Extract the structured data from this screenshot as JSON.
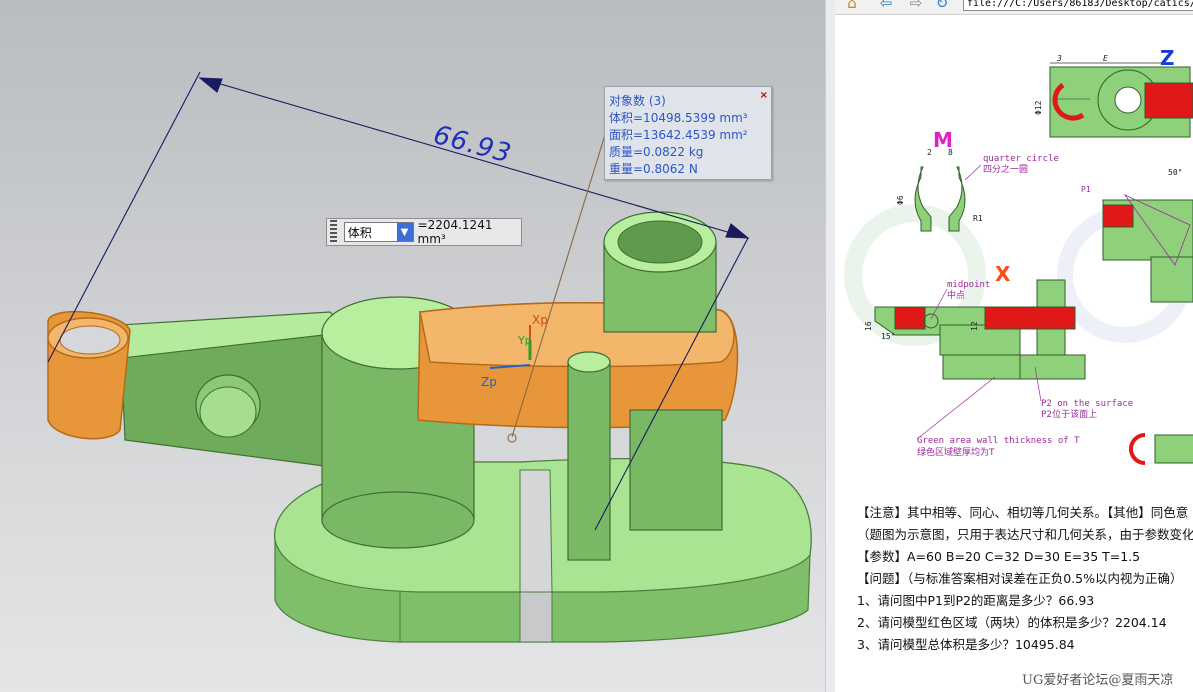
{
  "viewport": {
    "dimension_value": "66.93",
    "colors": {
      "model_green": "#8fd07a",
      "highlight_orange": "#f0a84a",
      "dim_line": "#1a1a5e"
    },
    "info_panel": {
      "lines": [
        "对象数 (3)",
        "体积=10498.5399 mm³",
        "面积=13642.4539 mm²",
        "质量=0.0822 kg",
        "重量=0.8062 N"
      ],
      "close": "×"
    },
    "measure_toolbar": {
      "select_value": "体积",
      "result": "=2204.1241 mm³"
    },
    "csys": {
      "x_label": "Xp",
      "y_label": "Yp",
      "z_label": "Zp"
    }
  },
  "browser": {
    "address": "file:///C:/Users/86183/Desktop/catics/",
    "drawing": {
      "view_labels": {
        "m": "M",
        "x": "X",
        "z": "Z"
      },
      "dims": {
        "three": "3",
        "e": "E",
        "phi12": "Φ12",
        "eight": "8",
        "two": "2",
        "phi6": "Φ6",
        "r1": "R1",
        "sixteen": "16",
        "twelve": "12",
        "fifteen": "15°",
        "fifty": "50°"
      },
      "annotations": {
        "quarter_en": "quarter circle",
        "quarter_cn": "四分之一圆",
        "midpoint_en": "midpoint",
        "midpoint_cn": "中点",
        "p1": "P1",
        "p2_en": "P2 on the surface",
        "p2_cn": "P2位于该面上",
        "green_en": "Green area wall thickness of T",
        "green_cn": "绿色区域壁厚均为T"
      }
    },
    "text_lines": [
      "【注意】其中相等、同心、相切等几何关系。【其他】同色意",
      "（题图为示意图，只用于表达尺寸和几何关系，由于参数变化",
      "【参数】A=60   B=20   C=32   D=30   E=35   T=1.5",
      "【问题】（与标准答案相对误差在正负0.5%以内视为正确）",
      "1、请问图中P1到P2的距离是多少？66.93",
      "2、请问模型红色区域（两块）的体积是多少？2204.14",
      "3、请问模型总体积是多少？10495.84"
    ],
    "watermark": "UG爱好者论坛@夏雨天凉"
  }
}
